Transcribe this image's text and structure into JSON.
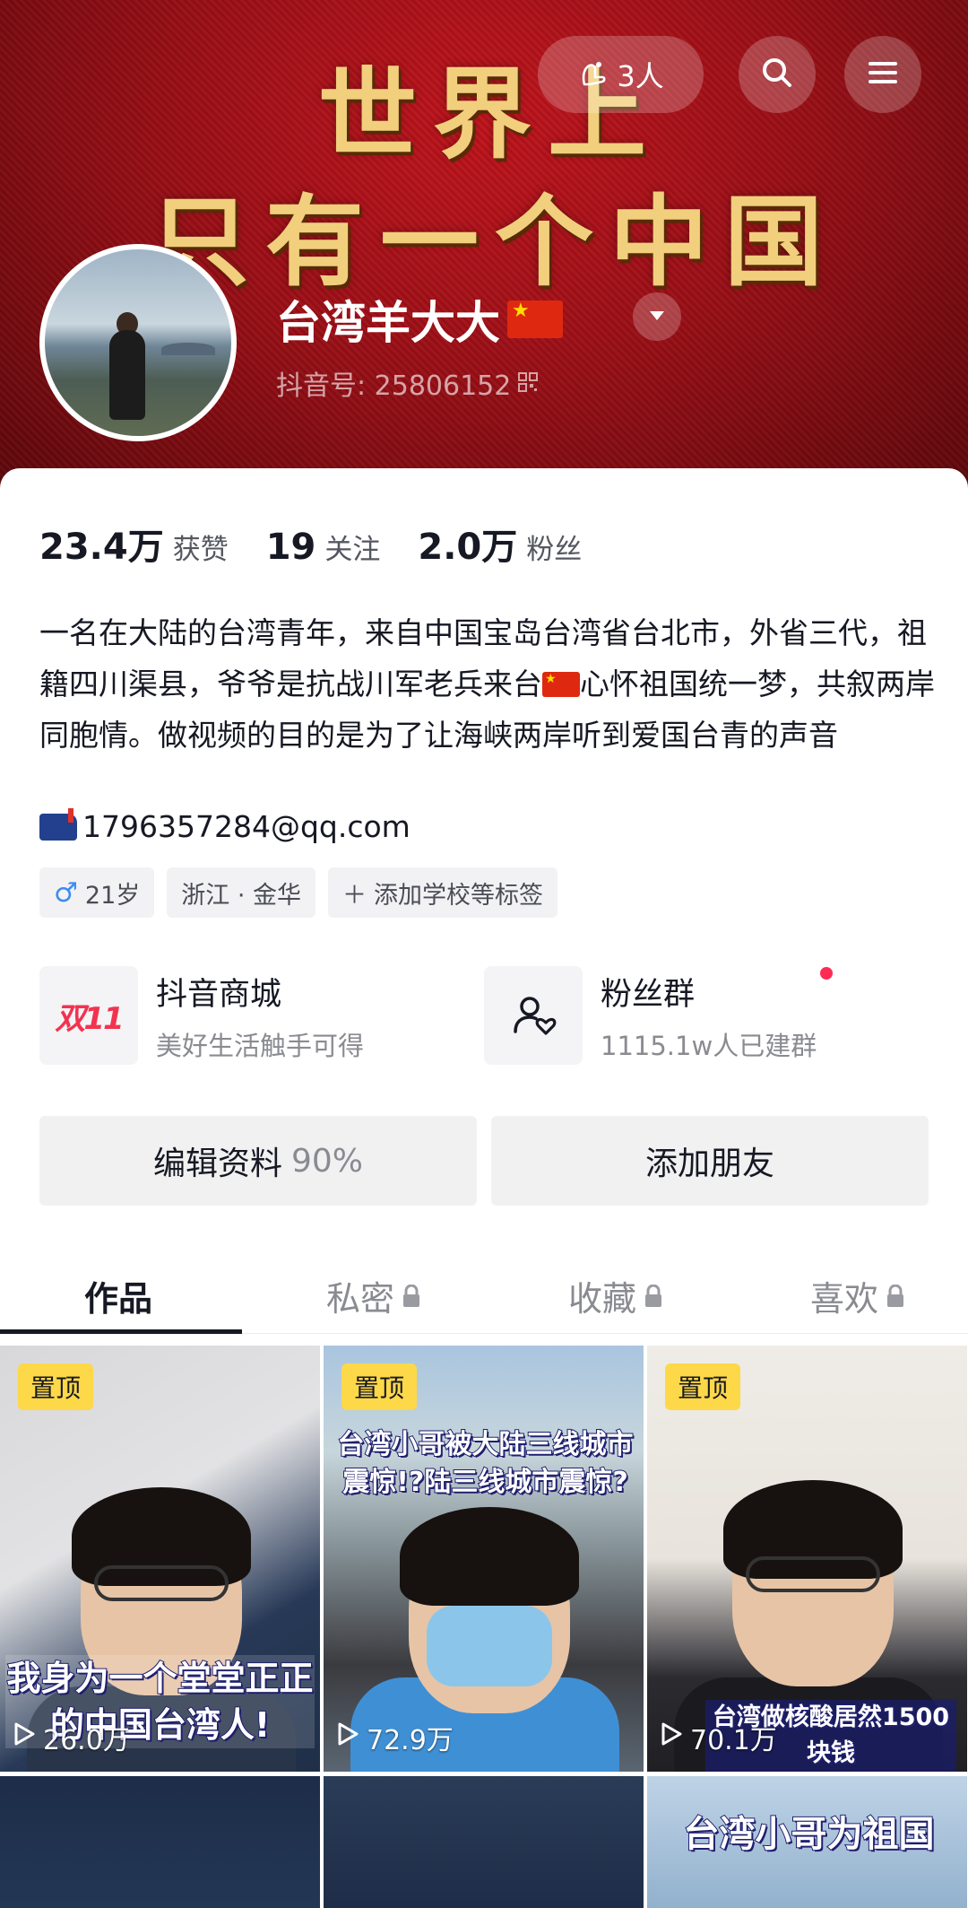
{
  "banner": {
    "line1": "世界上",
    "line2": "只有一个中国"
  },
  "topbar": {
    "visitors": "3人"
  },
  "profile": {
    "name": "台湾羊大大",
    "douyin_id": "抖音号: 25806152"
  },
  "stats": [
    {
      "value": "23.4万",
      "label": "获赞"
    },
    {
      "value": "19",
      "label": "关注"
    },
    {
      "value": "2.0万",
      "label": "粉丝"
    }
  ],
  "bio": {
    "part1": "一名在大陆的台湾青年，来自中国宝岛台湾省台北市，外省三代，祖籍四川渠县，爷爷是抗战川军老兵来台",
    "part2": "心怀祖国统一梦，共叙两岸同胞情。做视频的目的是为了让海峡两岸听到爱国台青的声音",
    "email": "1796357284@qq.com"
  },
  "tags": {
    "age": "21岁",
    "location": "浙江 · 金华",
    "add": "添加学校等标签"
  },
  "features": {
    "shop": {
      "icon_text": "双11",
      "title": "抖音商城",
      "subtitle": "美好生活触手可得"
    },
    "fans": {
      "title": "粉丝群",
      "subtitle": "1115.1w人已建群"
    }
  },
  "actions": {
    "edit": "编辑资料",
    "edit_progress": "90%",
    "add_friend": "添加朋友"
  },
  "tabs": {
    "works": "作品",
    "private": "私密",
    "favorites": "收藏",
    "likes": "喜欢"
  },
  "videos": [
    {
      "pinned": "置顶",
      "plays": "26.0万",
      "caption": "我身为一个堂堂正正的中国台湾人!"
    },
    {
      "pinned": "置顶",
      "plays": "72.9万",
      "caption": "台湾小哥被大陆三线城市震惊!?陆三线城市震惊?"
    },
    {
      "pinned": "置顶",
      "plays": "70.1万",
      "caption": "台湾做核酸居然1500块钱"
    },
    {
      "caption": ""
    },
    {
      "caption": ""
    },
    {
      "caption": "台湾小哥为祖国"
    }
  ],
  "colors": {
    "banner_red": "#9a0f16",
    "banner_gold": "#f1cf7d",
    "pin_yellow": "#fdd848",
    "accent_pink": "#fe2c55",
    "male_blue": "#3d8bf2"
  }
}
